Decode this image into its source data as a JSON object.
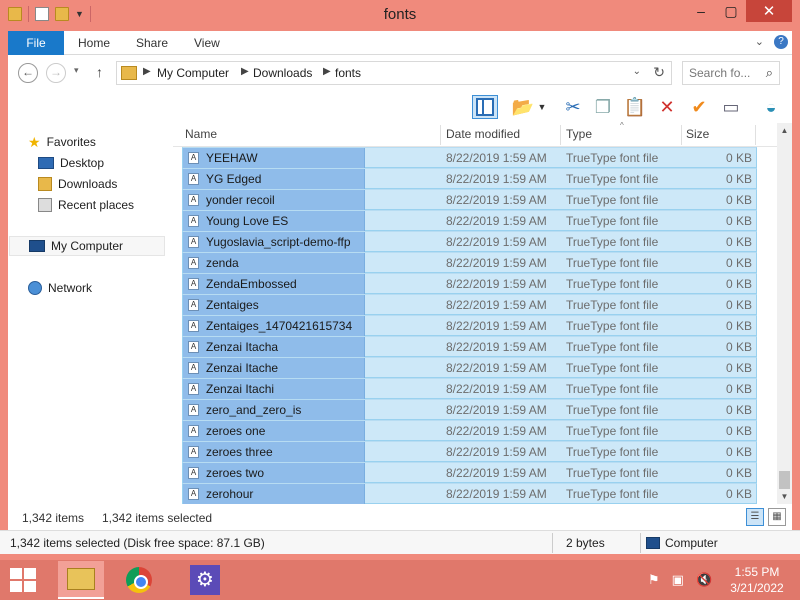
{
  "window": {
    "title": "fonts"
  },
  "ribbon": {
    "tabs": [
      "File",
      "Home",
      "Share",
      "View"
    ]
  },
  "address": {
    "crumbs": [
      "My Computer",
      "Downloads",
      "fonts"
    ],
    "search_placeholder": "Search fo..."
  },
  "nav": {
    "favorites": "Favorites",
    "desktop": "Desktop",
    "downloads": "Downloads",
    "recent": "Recent places",
    "my_computer": "My Computer",
    "network": "Network"
  },
  "columns": {
    "name": "Name",
    "date": "Date modified",
    "type": "Type",
    "size": "Size"
  },
  "files": [
    {
      "name": "YEEHAW",
      "date": "8/22/2019 1:59 AM",
      "type": "TrueType font file",
      "size": "0 KB"
    },
    {
      "name": "YG Edged",
      "date": "8/22/2019 1:59 AM",
      "type": "TrueType font file",
      "size": "0 KB"
    },
    {
      "name": "yonder recoil",
      "date": "8/22/2019 1:59 AM",
      "type": "TrueType font file",
      "size": "0 KB"
    },
    {
      "name": "Young Love ES",
      "date": "8/22/2019 1:59 AM",
      "type": "TrueType font file",
      "size": "0 KB"
    },
    {
      "name": "Yugoslavia_script-demo-ffp",
      "date": "8/22/2019 1:59 AM",
      "type": "TrueType font file",
      "size": "0 KB"
    },
    {
      "name": "zenda",
      "date": "8/22/2019 1:59 AM",
      "type": "TrueType font file",
      "size": "0 KB"
    },
    {
      "name": "ZendaEmbossed",
      "date": "8/22/2019 1:59 AM",
      "type": "TrueType font file",
      "size": "0 KB"
    },
    {
      "name": "Zentaiges",
      "date": "8/22/2019 1:59 AM",
      "type": "TrueType font file",
      "size": "0 KB"
    },
    {
      "name": "Zentaiges_1470421615734",
      "date": "8/22/2019 1:59 AM",
      "type": "TrueType font file",
      "size": "0 KB"
    },
    {
      "name": "Zenzai Itacha",
      "date": "8/22/2019 1:59 AM",
      "type": "TrueType font file",
      "size": "0 KB"
    },
    {
      "name": "Zenzai Itache",
      "date": "8/22/2019 1:59 AM",
      "type": "TrueType font file",
      "size": "0 KB"
    },
    {
      "name": "Zenzai Itachi",
      "date": "8/22/2019 1:59 AM",
      "type": "TrueType font file",
      "size": "0 KB"
    },
    {
      "name": "zero_and_zero_is",
      "date": "8/22/2019 1:59 AM",
      "type": "TrueType font file",
      "size": "0 KB"
    },
    {
      "name": "zeroes one",
      "date": "8/22/2019 1:59 AM",
      "type": "TrueType font file",
      "size": "0 KB"
    },
    {
      "name": "zeroes three",
      "date": "8/22/2019 1:59 AM",
      "type": "TrueType font file",
      "size": "0 KB"
    },
    {
      "name": "zeroes two",
      "date": "8/22/2019 1:59 AM",
      "type": "TrueType font file",
      "size": "0 KB"
    },
    {
      "name": "zerohour",
      "date": "8/22/2019 1:59 AM",
      "type": "TrueType font file",
      "size": "0 KB"
    }
  ],
  "status": {
    "items": "1,342 items",
    "selected": "1,342 items selected"
  },
  "details": {
    "summary": "1,342 items selected (Disk free space: 87.1 GB)",
    "size": "2 bytes",
    "location": "Computer"
  },
  "clock": {
    "time": "1:55 PM",
    "date": "3/21/2022"
  },
  "colors": {
    "frame": "#f08a7c",
    "selection": "#cde8f8",
    "selection_name": "#8fbcea",
    "accent": "#1979ca"
  }
}
